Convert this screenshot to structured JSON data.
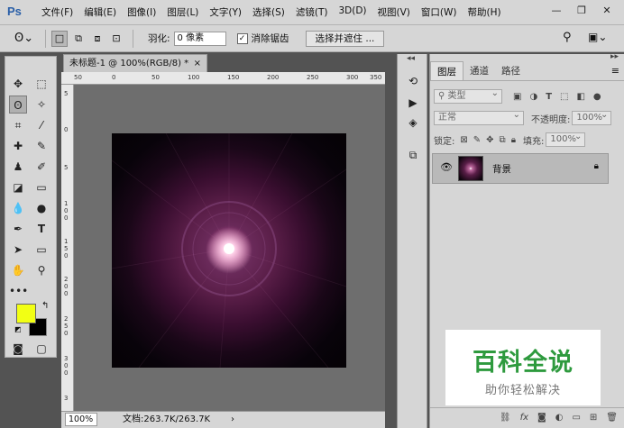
{
  "app": {
    "logo": "Ps"
  },
  "menu": [
    "文件(F)",
    "编辑(E)",
    "图像(I)",
    "图层(L)",
    "文字(Y)",
    "选择(S)",
    "滤镜(T)",
    "3D(D)",
    "视图(V)",
    "窗口(W)",
    "帮助(H)"
  ],
  "window_controls": {
    "minimize": "—",
    "restore": "❐",
    "close": "✕"
  },
  "options": {
    "feather_label": "羽化:",
    "feather_value": "0 像素",
    "antialias_label": "消除锯齿",
    "antialias_checked": true,
    "select_mask_button": "选择并遮住 ..."
  },
  "document": {
    "tab_title": "未标题-1 @ 100%(RGB/8) *",
    "tab_close": "×",
    "zoom": "100%",
    "doc_size": "文档:263.7K/263.7K",
    "status_arrow": "›"
  },
  "ruler": {
    "h_ticks": [
      "50",
      "0",
      "50",
      "100",
      "150",
      "200",
      "250",
      "300",
      "350"
    ],
    "v_ticks": [
      "5",
      "0",
      "5",
      "1 0 0",
      "1 5 0",
      "2 0 0",
      "2 5 0",
      "3 0 0",
      "3"
    ]
  },
  "layers_panel": {
    "tabs": [
      "图层",
      "通道",
      "路径"
    ],
    "active_tab": "图层",
    "filter_kind": "类型",
    "blend_mode": "正常",
    "opacity_label": "不透明度:",
    "opacity_value": "100%",
    "lock_label": "锁定:",
    "fill_label": "填充:",
    "fill_value": "100%",
    "layers": [
      {
        "name": "背景",
        "visible": true,
        "locked": true
      }
    ],
    "bottom_icons": [
      "link-icon",
      "fx-icon",
      "mask-icon",
      "adjustment-icon",
      "group-icon",
      "new-layer-icon",
      "trash-icon"
    ],
    "fx_label": "fx"
  },
  "colors": {
    "foreground": "#f2ff14",
    "background": "#000000"
  },
  "watermark": {
    "title": "百科全说",
    "subtitle": "助你轻松解决"
  }
}
